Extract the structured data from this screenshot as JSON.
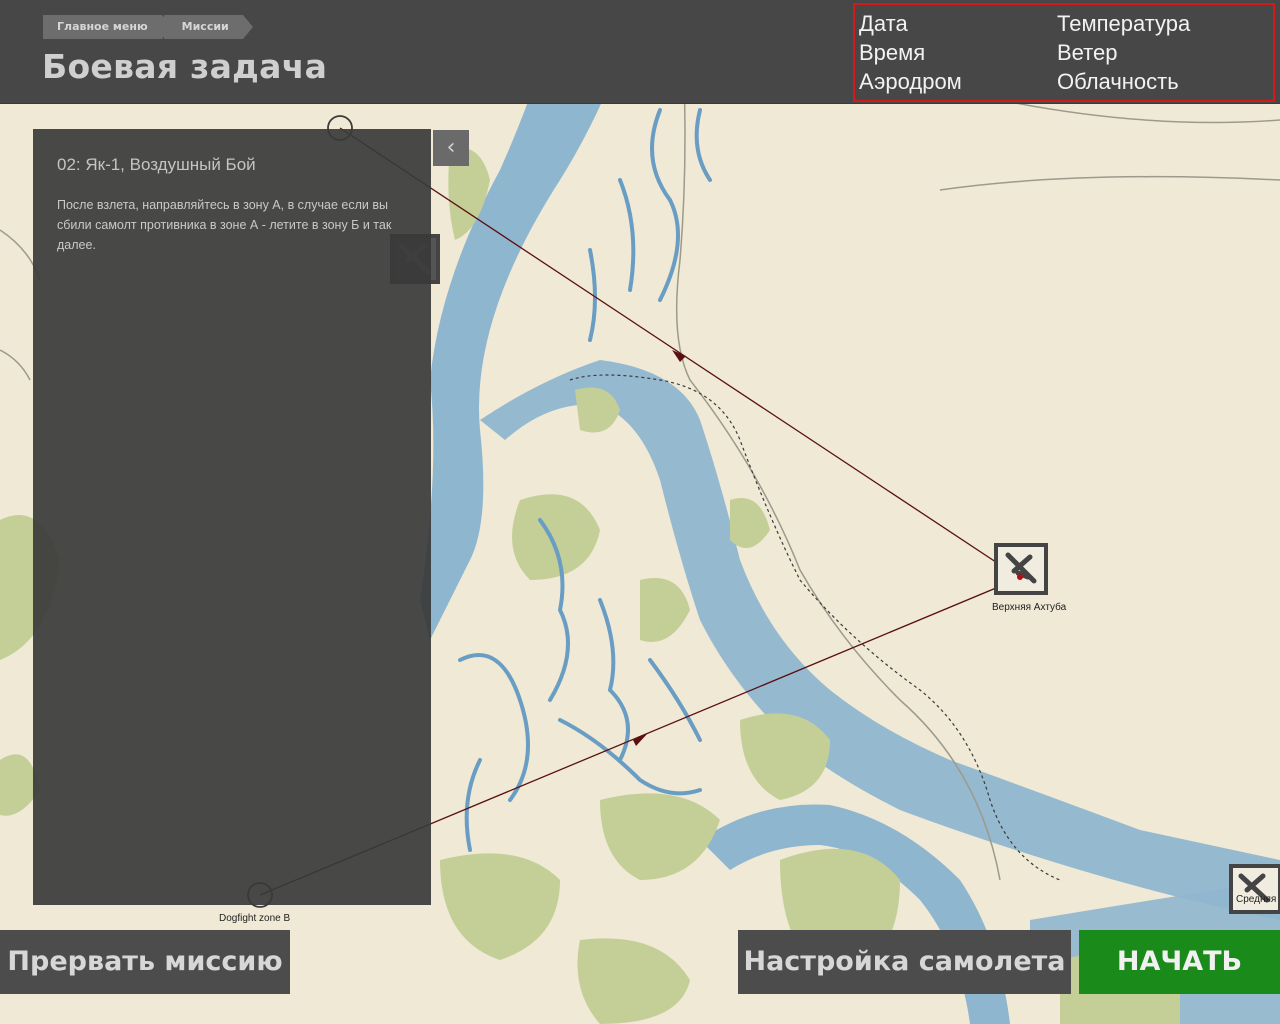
{
  "breadcrumb": {
    "items": [
      "Главное меню",
      "Миссии"
    ]
  },
  "page": {
    "title": "Боевая задача"
  },
  "weather": {
    "date_label": "Дата",
    "time_label": "Время",
    "airfield_label": "Аэродром",
    "temperature_label": "Температура",
    "wind_label": "Ветер",
    "clouds_label": "Облачность"
  },
  "briefing": {
    "title": "02: Як-1, Воздушный Бой",
    "text": "После взлета, направляйтесь в зону А, в случае если вы сбили самолт противника в зоне А - летите в зону Б и так далее."
  },
  "map": {
    "airfield_main_label": "Верхняя Ахтуба",
    "airfield_right_label": "Средняя",
    "zone_b_label": "Dogfight zone B",
    "airfield_icon": "airfield-plane-icon",
    "colors": {
      "land": "#efe9d6",
      "water": "#8fb6cf",
      "forest": "#c4cf98",
      "route": "#5a1010"
    }
  },
  "buttons": {
    "abort": "Прервать миссию",
    "plane_setup": "Настройка самолета",
    "start": "НАЧАТЬ"
  },
  "colors": {
    "start_button": "#1a8a1a",
    "weather_border": "#d21a1a"
  }
}
